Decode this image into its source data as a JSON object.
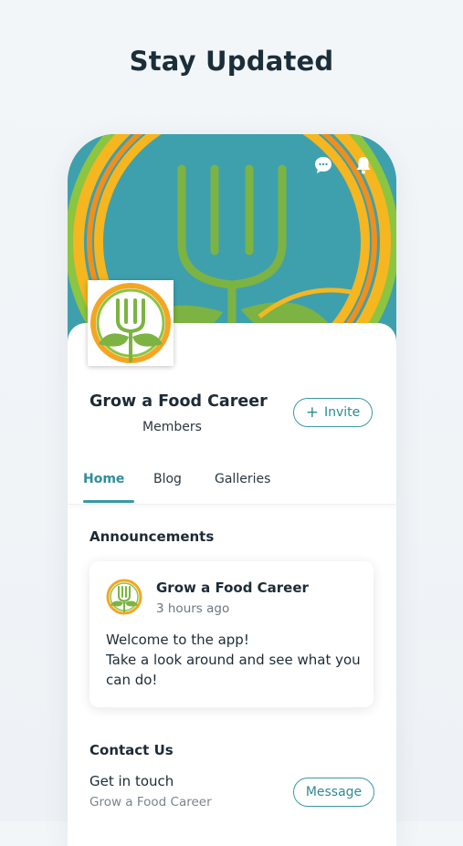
{
  "headline": "Stay Updated",
  "header_icons": [
    "chat-icon",
    "bell-icon"
  ],
  "group": {
    "name": "Grow a Food Career",
    "members_label": "Members",
    "invite_label": "Invite",
    "invite_icon": "plus-icon"
  },
  "tabs": [
    {
      "label": "Home",
      "active": true
    },
    {
      "label": "Blog",
      "active": false
    },
    {
      "label": "Galleries",
      "active": false
    }
  ],
  "announcements": {
    "title": "Announcements",
    "post": {
      "author": "Grow a Food Career",
      "time": "3 hours ago",
      "body_lines": [
        "Welcome to the app!",
        "Take a look around and see what you",
        "can do!"
      ]
    }
  },
  "contact": {
    "title": "Contact Us",
    "label": "Get in touch",
    "sub": "Grow a Food Career",
    "button": "Message"
  },
  "colors": {
    "accent": "#3a98a4",
    "cover_teal": "#3ea0ad",
    "logo_orange": "#f4a623",
    "logo_green": "#7cb342"
  }
}
